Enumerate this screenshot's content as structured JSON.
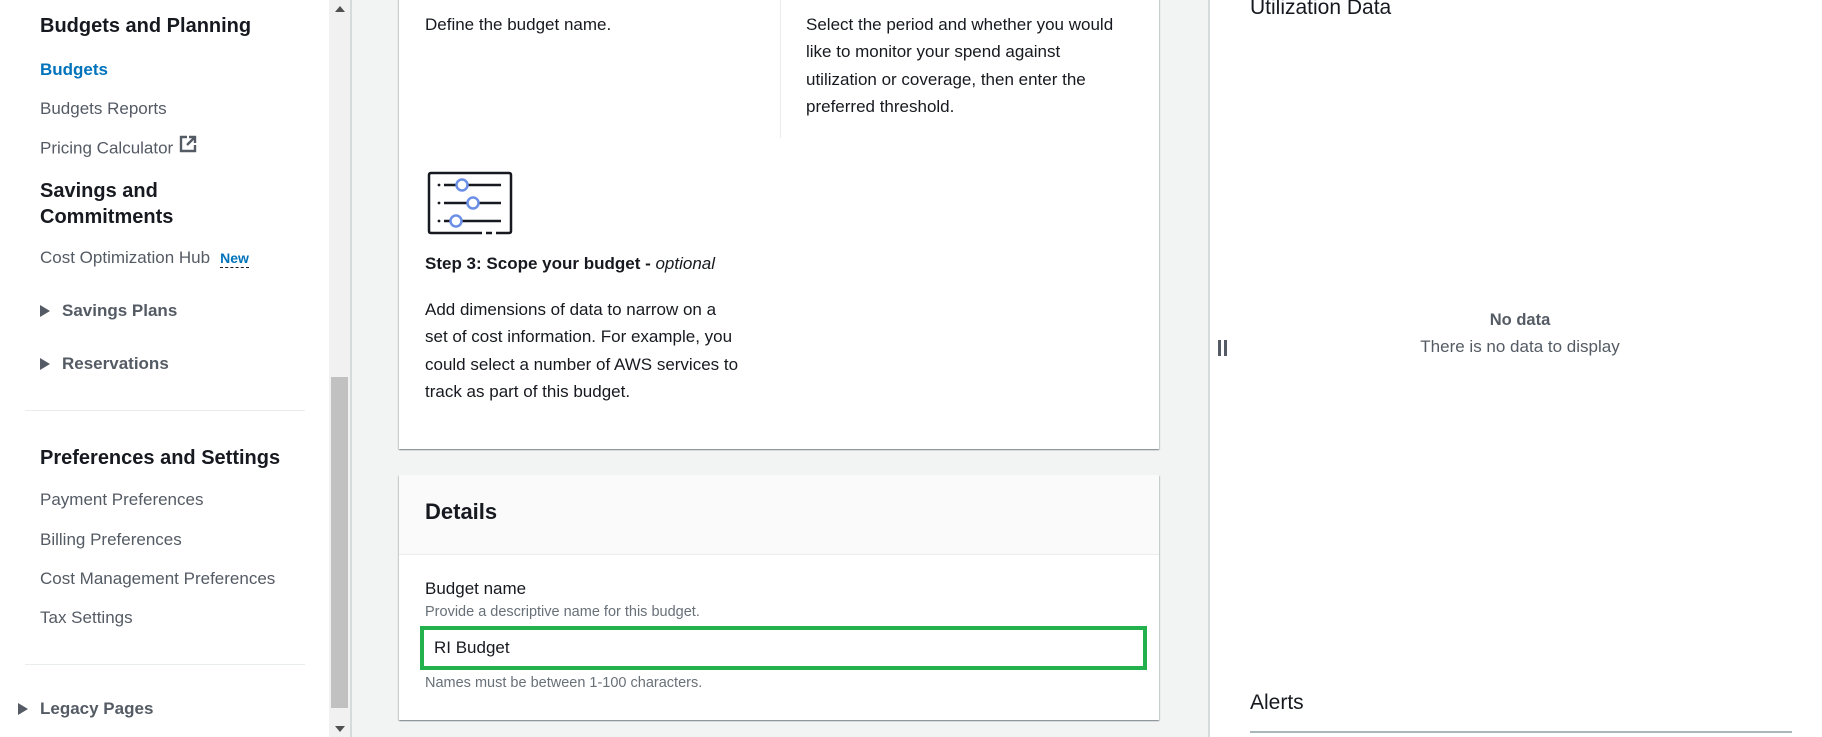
{
  "sidebar": {
    "budgets_planning_heading": "Budgets and Planning",
    "budgets": "Budgets",
    "budgets_reports": "Budgets Reports",
    "pricing_calculator": "Pricing Calculator",
    "savings_heading_line1": "Savings and",
    "savings_heading_line2": "Commitments",
    "cost_optimization_hub": "Cost Optimization Hub",
    "new_badge": "New",
    "savings_plans": "Savings Plans",
    "reservations": "Reservations",
    "preferences_heading": "Preferences and Settings",
    "payment_preferences": "Payment Preferences",
    "billing_preferences": "Billing Preferences",
    "cost_management_preferences": "Cost Management Preferences",
    "tax_settings": "Tax Settings",
    "legacy_pages": "Legacy Pages"
  },
  "steps": {
    "step1_desc": "Define the budget name.",
    "step2_desc_lines": [
      "Select the period and whether you would",
      "like to monitor your spend against",
      "utilization or coverage, then enter the",
      "preferred threshold."
    ],
    "step3_title": "Step 3: Scope your budget - ",
    "step3_optional": "optional",
    "step3_desc_lines": [
      "Add dimensions of data to narrow on a",
      "set of cost information. For example, you",
      "could select a number of AWS services to",
      "track as part of this budget."
    ]
  },
  "details": {
    "title": "Details",
    "budget_name_label": "Budget name",
    "budget_name_hint": "Provide a descriptive name for this budget.",
    "budget_name_value": "RI Budget",
    "budget_name_constraint": "Names must be between 1-100 characters."
  },
  "right_panel": {
    "utilization_title": "Utilization Data",
    "no_data_title": "No data",
    "no_data_message": "There is no data to display",
    "alerts_title": "Alerts"
  },
  "colors": {
    "active_link": "#0073bb",
    "input_highlight": "#22b14c"
  }
}
